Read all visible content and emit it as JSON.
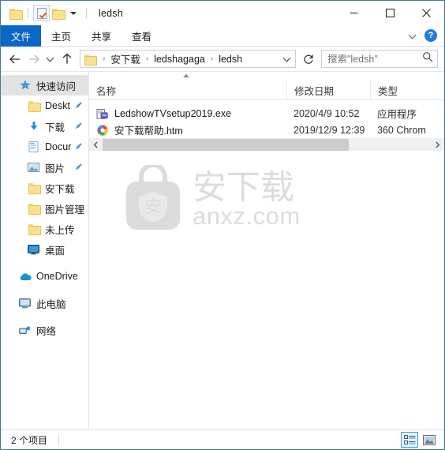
{
  "window": {
    "title": "ledsh",
    "quick_access": [
      "folder-icon",
      "properties-icon",
      "new-folder-icon",
      "customize-dropdown-icon"
    ],
    "controls": {
      "minimize": "minimize-icon",
      "maximize": "maximize-icon",
      "close": "close-icon"
    }
  },
  "ribbon": {
    "tabs": [
      {
        "label": "文件",
        "active": true
      },
      {
        "label": "主页",
        "active": false
      },
      {
        "label": "共享",
        "active": false
      },
      {
        "label": "查看",
        "active": false
      }
    ],
    "expand_icon": "chevron-down-icon",
    "help_label": "?"
  },
  "address": {
    "back_icon": "back-arrow-icon",
    "forward_icon": "forward-arrow-icon",
    "recent_icon": "recent-locations-icon",
    "up_icon": "up-arrow-icon",
    "crumbs": [
      "安下载",
      "ledshagaga",
      "ledsh"
    ],
    "separator": "›",
    "dropdown_icon": "chevron-down-icon",
    "refresh_icon": "refresh-icon"
  },
  "search": {
    "placeholder": "搜索\"ledsh\"",
    "value": "",
    "icon": "search-icon"
  },
  "sidebar": {
    "items": [
      {
        "label": "快速访问",
        "icon": "star-pin-icon",
        "selected": true,
        "indent": false,
        "pinned": false
      },
      {
        "label": "Deskt",
        "icon": "folder-icon",
        "selected": false,
        "indent": true,
        "pinned": true
      },
      {
        "label": "下载",
        "icon": "download-icon",
        "selected": false,
        "indent": true,
        "pinned": true
      },
      {
        "label": "Docur",
        "icon": "documents-icon",
        "selected": false,
        "indent": true,
        "pinned": true
      },
      {
        "label": "图片",
        "icon": "pictures-icon",
        "selected": false,
        "indent": true,
        "pinned": true
      },
      {
        "label": "安下载",
        "icon": "folder-icon",
        "selected": false,
        "indent": true,
        "pinned": false
      },
      {
        "label": "图片管理",
        "icon": "folder-icon",
        "selected": false,
        "indent": true,
        "pinned": false
      },
      {
        "label": "未上传",
        "icon": "folder-icon",
        "selected": false,
        "indent": true,
        "pinned": false
      },
      {
        "label": "桌面",
        "icon": "desktop-icon",
        "selected": false,
        "indent": true,
        "pinned": false
      },
      {
        "label": "OneDrive",
        "icon": "onedrive-icon",
        "selected": false,
        "indent": false,
        "pinned": false,
        "gap_before": true
      },
      {
        "label": "此电脑",
        "icon": "this-pc-icon",
        "selected": false,
        "indent": false,
        "pinned": false,
        "gap_before": true
      },
      {
        "label": "网络",
        "icon": "network-icon",
        "selected": false,
        "indent": false,
        "pinned": false,
        "gap_before": true
      }
    ]
  },
  "filelist": {
    "columns": [
      {
        "label": "名称",
        "sorted": "asc"
      },
      {
        "label": "修改日期",
        "sorted": ""
      },
      {
        "label": "类型",
        "sorted": ""
      }
    ],
    "rows": [
      {
        "name": "LedshowTVsetup2019.exe",
        "date": "2020/4/9 10:52",
        "type": "应用程序",
        "icon": "installer-icon"
      },
      {
        "name": "安下载帮助.htm",
        "date": "2019/12/9 12:39",
        "type": "360 Chrom",
        "icon": "chrome-360-icon"
      }
    ]
  },
  "watermark": {
    "text_cn": "安下载",
    "text_en": "anxz.com",
    "logo_glyph": "安",
    "color": "#dcdcdc"
  },
  "scrollbar": {
    "left_icon": "chevron-left-icon",
    "right_icon": "chevron-right-icon"
  },
  "statusbar": {
    "item_count": "2 个项目",
    "views": [
      {
        "name": "details-view",
        "active": true
      },
      {
        "name": "large-icons-view",
        "active": false
      }
    ]
  },
  "colors": {
    "accent": "#0a67c8",
    "window_border": "#3f7d8c",
    "folder_yellow": "#fbe08f",
    "selection_gray": "#e3e3e3"
  }
}
